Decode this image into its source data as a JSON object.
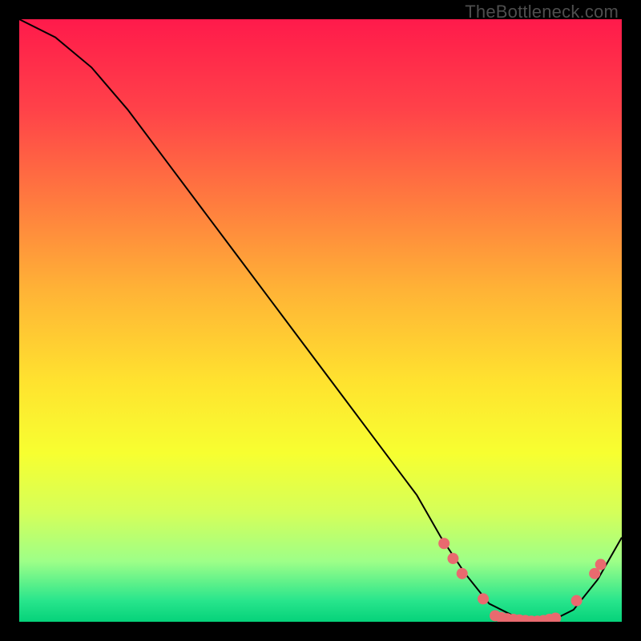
{
  "watermark": "TheBottleneck.com",
  "chart_data": {
    "type": "line",
    "title": "",
    "xlabel": "",
    "ylabel": "",
    "xlim": [
      0,
      100
    ],
    "ylim": [
      0,
      100
    ],
    "grid": false,
    "legend": false,
    "background_gradient": {
      "stops": [
        {
          "offset": 0.0,
          "color": "#ff1a4b"
        },
        {
          "offset": 0.15,
          "color": "#ff4249"
        },
        {
          "offset": 0.3,
          "color": "#ff7a3f"
        },
        {
          "offset": 0.45,
          "color": "#ffb336"
        },
        {
          "offset": 0.6,
          "color": "#ffe22f"
        },
        {
          "offset": 0.72,
          "color": "#f7ff30"
        },
        {
          "offset": 0.82,
          "color": "#d4ff5a"
        },
        {
          "offset": 0.9,
          "color": "#9dff88"
        },
        {
          "offset": 0.965,
          "color": "#28e58c"
        },
        {
          "offset": 1.0,
          "color": "#05d27a"
        }
      ]
    },
    "series": [
      {
        "name": "bottleneck-curve",
        "color": "#000000",
        "x": [
          0,
          6,
          12,
          18,
          24,
          30,
          36,
          42,
          48,
          54,
          60,
          66,
          70,
          74,
          78,
          82,
          85,
          88,
          92,
          96,
          100
        ],
        "values": [
          100,
          97,
          92,
          85,
          77,
          69,
          61,
          53,
          45,
          37,
          29,
          21,
          14,
          8,
          3,
          1,
          0,
          0,
          2,
          7,
          14
        ]
      }
    ],
    "markers": {
      "name": "highlighted-points",
      "color": "#e96a6f",
      "points": [
        {
          "x": 70.5,
          "y": 13.0
        },
        {
          "x": 72.0,
          "y": 10.5
        },
        {
          "x": 73.5,
          "y": 8.0
        },
        {
          "x": 77.0,
          "y": 3.8
        },
        {
          "x": 79.0,
          "y": 1.0
        },
        {
          "x": 80.0,
          "y": 0.7
        },
        {
          "x": 81.0,
          "y": 0.5
        },
        {
          "x": 82.0,
          "y": 0.4
        },
        {
          "x": 83.0,
          "y": 0.3
        },
        {
          "x": 84.0,
          "y": 0.2
        },
        {
          "x": 85.0,
          "y": 0.1
        },
        {
          "x": 86.0,
          "y": 0.1
        },
        {
          "x": 87.0,
          "y": 0.2
        },
        {
          "x": 88.0,
          "y": 0.4
        },
        {
          "x": 89.0,
          "y": 0.6
        },
        {
          "x": 92.5,
          "y": 3.5
        },
        {
          "x": 95.5,
          "y": 8.0
        },
        {
          "x": 96.5,
          "y": 9.5
        }
      ]
    }
  }
}
